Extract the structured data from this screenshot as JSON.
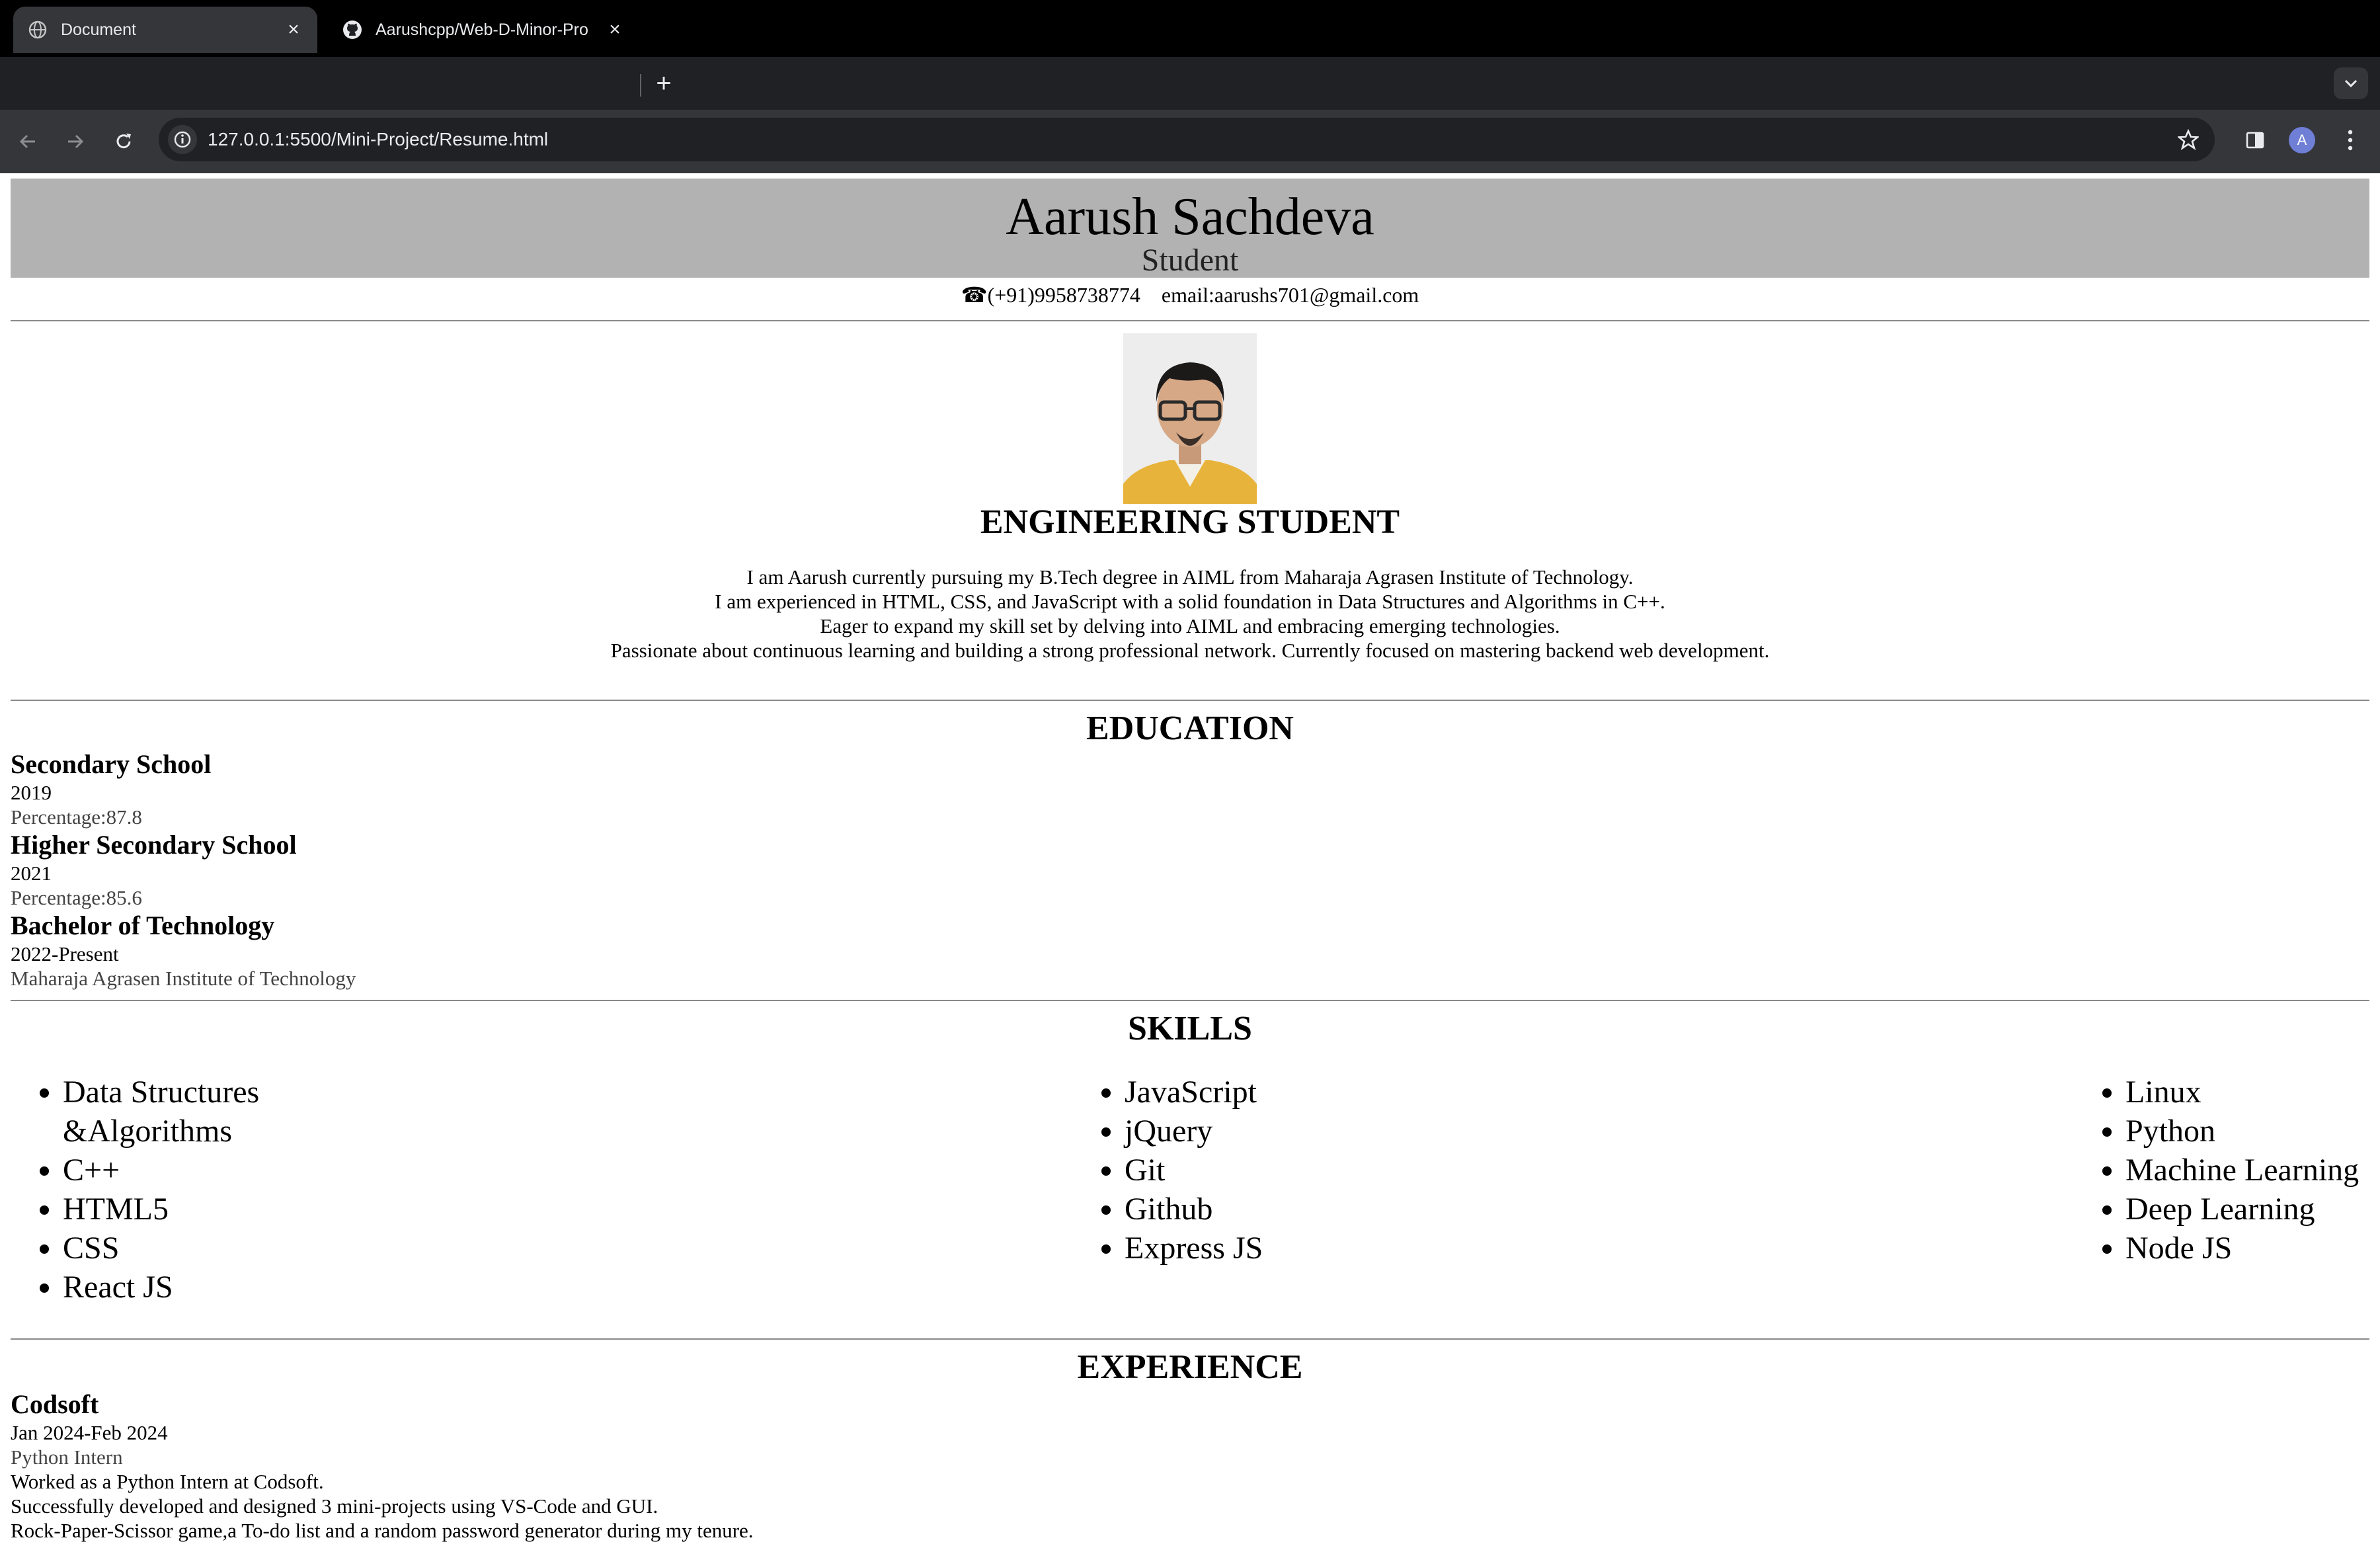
{
  "browser": {
    "tabs": [
      {
        "title": "Document",
        "active": true
      },
      {
        "title": "Aarushcpp/Web-D-Minor-Pro",
        "active": false
      }
    ],
    "url": "127.0.0.1:5500/Mini-Project/Resume.html",
    "avatar_letter": "A"
  },
  "resume": {
    "name": "Aarush Sachdeva",
    "role": "Student",
    "phone": "☎(+91)9958738774",
    "email": "email:aarushs701@gmail.com",
    "about_heading": "ENGINEERING STUDENT",
    "about_lines": [
      "I am Aarush currently pursuing my B.Tech degree in AIML from Maharaja Agrasen Institute of Technology.",
      "I am experienced in HTML, CSS, and JavaScript with a solid foundation in Data Structures and Algorithms in C++.",
      "Eager to expand my skill set by delving into AIML and embracing emerging technologies.",
      "Passionate about continuous learning and building a strong professional network. Currently focused on mastering backend web development."
    ],
    "education_heading": "EDUCATION",
    "education": [
      {
        "title": "Secondary School",
        "year": "2019",
        "detail": "Percentage:87.8"
      },
      {
        "title": "Higher Secondary School",
        "year": "2021",
        "detail": "Percentage:85.6"
      },
      {
        "title": "Bachelor of Technology",
        "year": "2022-Present",
        "detail": "Maharaja Agrasen Institute of Technology"
      }
    ],
    "skills_heading": "SKILLS",
    "skills": [
      [
        "Data Structures &Algorithms",
        "C++",
        "HTML5",
        "CSS",
        "React JS"
      ],
      [
        "JavaScript",
        "jQuery",
        "Git",
        "Github",
        "Express JS"
      ],
      [
        "Linux",
        "Python",
        "Machine Learning",
        "Deep Learning",
        "Node JS"
      ]
    ],
    "experience_heading": "EXPERIENCE",
    "experience": {
      "company": "Codsoft",
      "dates": "Jan 2024-Feb 2024",
      "position": "Python Intern",
      "lines": [
        "Worked as a Python Intern at Codsoft.",
        "Successfully developed and designed 3 mini-projects using VS-Code and GUI.",
        "Rock-Paper-Scissor game,a To-do list and a random password generator during my tenure."
      ]
    }
  }
}
